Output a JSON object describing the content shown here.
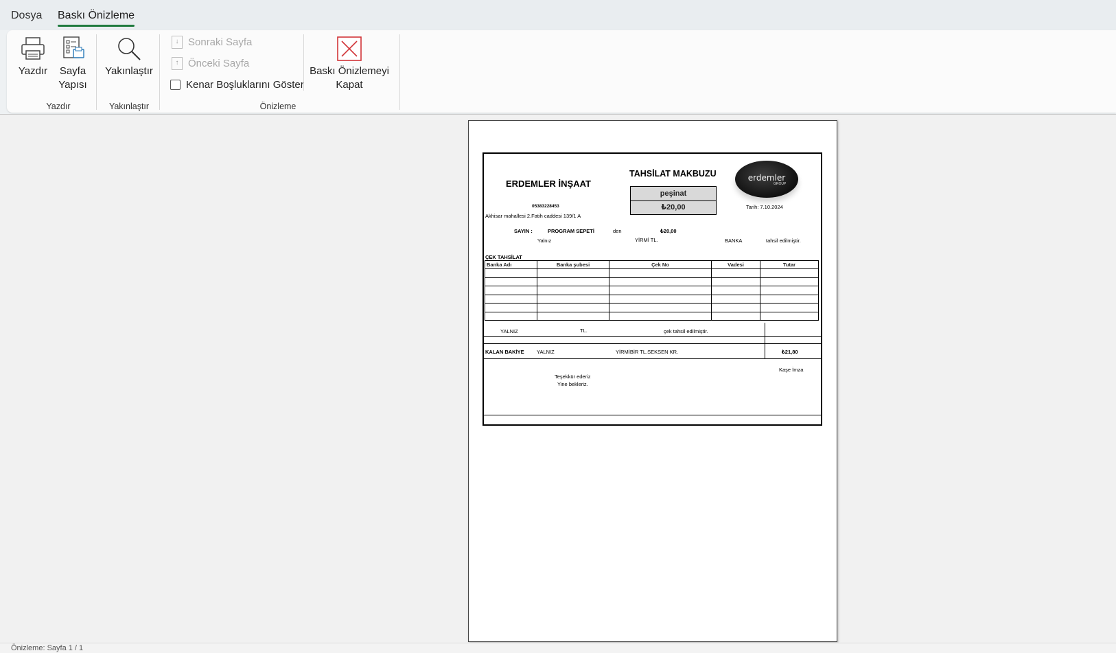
{
  "tabs": {
    "file": "Dosya",
    "print_preview": "Baskı Önizleme"
  },
  "ribbon": {
    "print": "Yazdır",
    "page_setup": "Sayfa Yapısı",
    "page_setup_line1": "Sayfa",
    "page_setup_line2": "Yapısı",
    "zoom": "Yakınlaştır",
    "next_page": "Sonraki Sayfa",
    "prev_page": "Önceki Sayfa",
    "show_margins": "Kenar Boşluklarını Göster",
    "close_line1": "Baskı Önizlemeyi",
    "close_line2": "Kapat",
    "groups": {
      "print": "Yazdır",
      "zoom": "Yakınlaştır",
      "preview": "Önizleme"
    }
  },
  "receipt": {
    "company": "ERDEMLER İNŞAAT",
    "title": "TAHSİLAT MAKBUZU",
    "payment_type": "peşinat",
    "amount": "₺20,00",
    "logo_text": "erdemler",
    "logo_sub": "GROUP",
    "date": "Tarih: 7.10.2024",
    "phone": "05383228453",
    "address": "Akhisar mahallesi 2.Fatih caddesi 139/1 A",
    "sayin_label": "SAYIN :",
    "customer": "PROGRAM SEPETİ",
    "den": "den",
    "amount_small": "₺20,00",
    "yalniz_label": "Yalnız",
    "amount_words": "YİRMİ TL.",
    "banka": "BANKA",
    "collected": "tahsil edilmiştir.",
    "cek_title": "ÇEK TAHSİLAT",
    "cek_headers": [
      "Banka Adı",
      "Banka şubesi",
      "Çek No",
      "Vadesi",
      "Tutar"
    ],
    "cek_yalniz": "YALNIZ",
    "cek_tl": "TL.",
    "cek_collected": "çek tahsil edilmiştir.",
    "kalan_label": "KALAN BAKİYE",
    "kalan_yalniz": "YALNIZ",
    "kalan_words": "YİRMİBİR TL.SEKSEN KR.",
    "kalan_amount": "₺21,80",
    "kase_imza": "Kaşe İmza",
    "thanks": "Teşekkür ederiz",
    "again": "Yine bekleriz."
  },
  "status": {
    "text": "Önizleme: Sayfa 1 / 1"
  }
}
